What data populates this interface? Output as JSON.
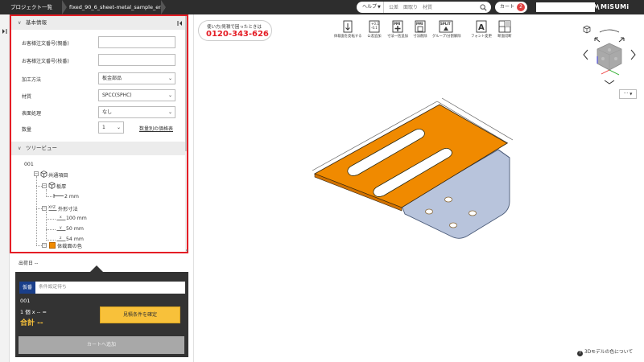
{
  "topbar": {
    "crumbs": [
      "プロジェクト一覧",
      "fixed_90_6_sheet-metal_sample_er..."
    ],
    "help_label": "ヘルプ",
    "search_placeholder": "公差　面取り　材質",
    "cart_label": "カート",
    "cart_count": "2",
    "logo": "MiSUMi"
  },
  "panel": {
    "basic_section_title": "基本情報",
    "fields": [
      {
        "label": "お客様注文番号(親番)",
        "value": ""
      },
      {
        "label": "お客様注文番号(枝番)",
        "value": ""
      },
      {
        "label": "加工方法",
        "value": "板金部品"
      },
      {
        "label": "材質",
        "value": "SPCC(SPHC)"
      },
      {
        "label": "表面処理",
        "value": "なし"
      },
      {
        "label": "数量",
        "value": "1"
      }
    ],
    "quantity_link": "数量別の価格表",
    "tree_section_title": "ツリービュー",
    "tree": {
      "root": "001",
      "common": "共通項目",
      "thickness": "板厚",
      "thickness_value": "2 mm",
      "outer_dims": "外形寸法",
      "dim_x": "100 mm",
      "dim_y": "50 mm",
      "dim_z": "54 mm",
      "body_color": "体裁面の色"
    }
  },
  "summary": {
    "ship_date": "出荷日 --",
    "provisional_badge": "仮番",
    "provisional_text": "条件設定待ち",
    "part_id": "001",
    "qty_line": "1 個 x -- =",
    "total": "合計 --",
    "confirm_label": "見積条件を確定",
    "cart_add_label": "カートへ追加"
  },
  "viewer": {
    "phone_caption": "使い方/見積で困ったときは",
    "phone_number": "0120-343-626",
    "tools": [
      {
        "icon": "body-flip-icon",
        "label": "体裁面を反転する"
      },
      {
        "icon": "tolerance-add-icon",
        "label": "公差追加"
      },
      {
        "icon": "pmi-add-icon",
        "label": "寸法一括追加"
      },
      {
        "icon": "pmi-delete-icon",
        "label": "寸法削除"
      },
      {
        "icon": "split-icon",
        "label": "グループ/分割解除"
      },
      {
        "icon": "font-icon",
        "label": "フォント変更"
      },
      {
        "icon": "section-view-icon",
        "label": "断面切断"
      }
    ],
    "more_label": "···",
    "color_note": "3Dモデルの色について",
    "colors": {
      "plate_top": "#f08a00",
      "plate_side": "#b8c4dc",
      "accent_red": "#e41e26",
      "cart_badge": "#e04040",
      "confirm_yellow": "#f8c13a",
      "provisional_blue": "#1a3f8a"
    }
  }
}
